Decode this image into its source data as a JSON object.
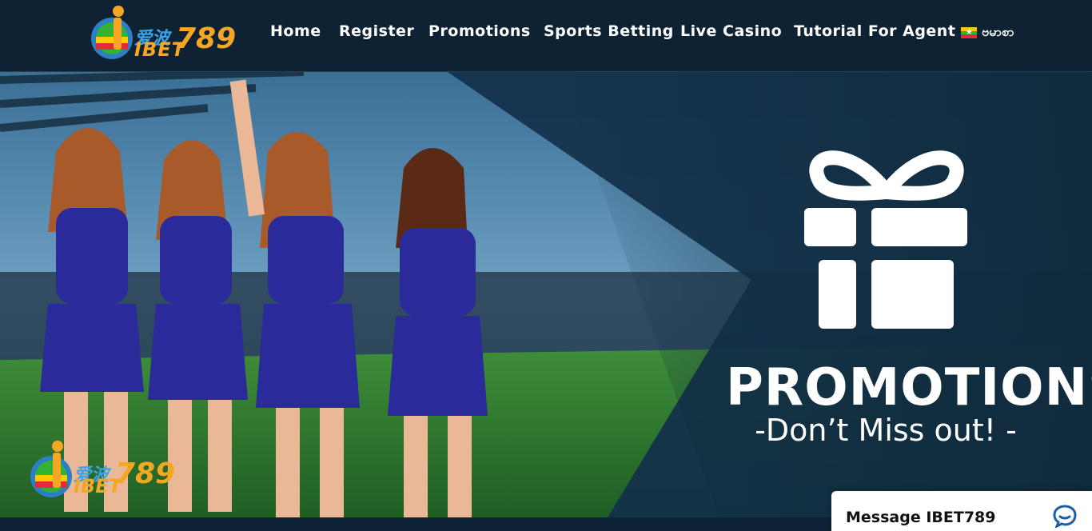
{
  "header": {
    "logo": {
      "cn_text": "爱波",
      "en_text": "IBET",
      "num_text": "789"
    },
    "nav": [
      {
        "label": "Home"
      },
      {
        "label": "Register"
      },
      {
        "label": "Promotions"
      },
      {
        "label": "Sports Betting"
      },
      {
        "label": "Live Casino"
      },
      {
        "label": "Tutorial For Agent"
      }
    ],
    "language": {
      "label": "ဗမာစာ",
      "flag": "myanmar-flag-icon"
    }
  },
  "banner": {
    "title": "PROMOTIONS",
    "subtitle": "-Don’t Miss out! -",
    "icon": "gift-icon",
    "watermark_logo": {
      "cn_text": "爱波",
      "en_text": "IBET",
      "num_text": "789"
    }
  },
  "chat": {
    "label": "Message IBET789",
    "icon": "chat-bubble-icon"
  },
  "colors": {
    "header_bg": "#0e2233",
    "accent_orange": "#f5a623",
    "accent_blue": "#3aa3e6",
    "text": "#ffffff"
  }
}
